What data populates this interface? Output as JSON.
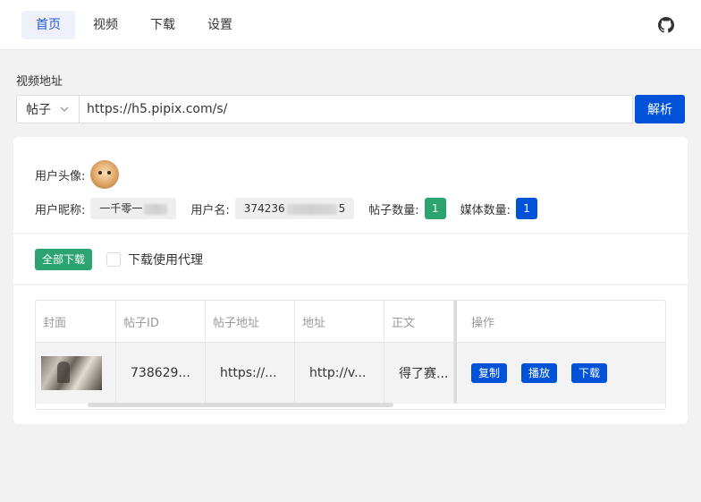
{
  "nav": {
    "items": [
      {
        "label": "首页",
        "active": true
      },
      {
        "label": "视频"
      },
      {
        "label": "下载"
      },
      {
        "label": "设置"
      }
    ],
    "github_icon": "github-icon"
  },
  "form": {
    "label": "视频地址",
    "type_select": "帖子",
    "url_value": "https://h5.pipix.com/s/",
    "parse_label": "解析"
  },
  "user": {
    "avatar_label": "用户头像:",
    "nickname_label": "用户昵称:",
    "nickname_value": "一千零一",
    "username_label": "用户名:",
    "username_value": "374236",
    "username_suffix": "5",
    "post_count_label": "帖子数量:",
    "post_count": "1",
    "media_count_label": "媒体数量:",
    "media_count": "1"
  },
  "actions": {
    "download_all": "全部下载",
    "proxy_label": "下载使用代理"
  },
  "table": {
    "columns": [
      "封面",
      "帖子ID",
      "帖子地址",
      "地址",
      "正文",
      "操作"
    ],
    "rows": [
      {
        "post_id": "738629...",
        "post_url": "https://...",
        "addr": "http://v...",
        "text": "得了赛...",
        "ops": [
          "复制",
          "播放",
          "下载"
        ]
      }
    ]
  },
  "colors": {
    "primary": "#0052d9",
    "success": "#2ba471",
    "nav_active_bg": "#eef1fb"
  }
}
